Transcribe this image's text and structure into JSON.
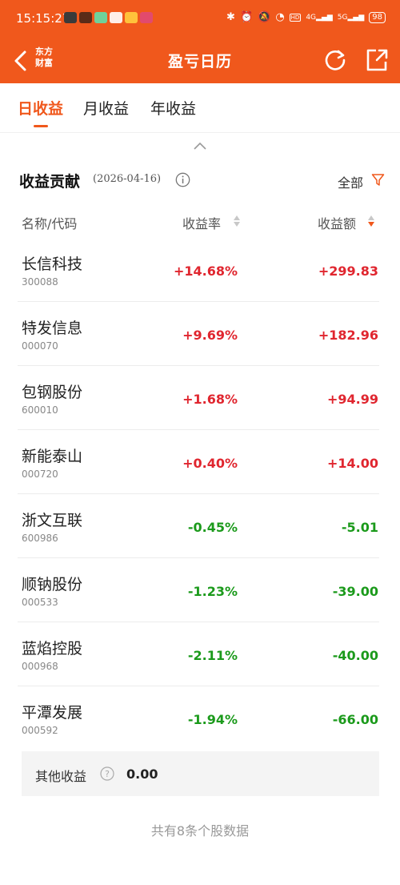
{
  "status_bar": {
    "time": "15:15:27",
    "network_4g": "4G",
    "network_5g": "5G",
    "hd_label": "HD",
    "battery": "98"
  },
  "nav": {
    "brand_line1": "东方",
    "brand_line2": "财富",
    "title": "盈亏日历"
  },
  "tabs": [
    {
      "label": "日收益",
      "active": true
    },
    {
      "label": "月收益",
      "active": false
    },
    {
      "label": "年收益",
      "active": false
    }
  ],
  "section": {
    "title": "收益贡献",
    "date": "(2026-04-16)",
    "filter_label": "全部"
  },
  "table": {
    "col_name": "名称/代码",
    "col_rate": "收益率",
    "col_amount": "收益额",
    "rows": [
      {
        "name": "长信科技",
        "code": "300088",
        "rate": "+14.68%",
        "amount": "+299.83",
        "direction": "up"
      },
      {
        "name": "特发信息",
        "code": "000070",
        "rate": "+9.69%",
        "amount": "+182.96",
        "direction": "up"
      },
      {
        "name": "包钢股份",
        "code": "600010",
        "rate": "+1.68%",
        "amount": "+94.99",
        "direction": "up"
      },
      {
        "name": "新能泰山",
        "code": "000720",
        "rate": "+0.40%",
        "amount": "+14.00",
        "direction": "up"
      },
      {
        "name": "浙文互联",
        "code": "600986",
        "rate": "-0.45%",
        "amount": "-5.01",
        "direction": "down"
      },
      {
        "name": "顺钠股份",
        "code": "000533",
        "rate": "-1.23%",
        "amount": "-39.00",
        "direction": "down"
      },
      {
        "name": "蓝焰控股",
        "code": "000968",
        "rate": "-2.11%",
        "amount": "-40.00",
        "direction": "down"
      },
      {
        "name": "平潭发展",
        "code": "000592",
        "rate": "-1.94%",
        "amount": "-66.00",
        "direction": "down"
      }
    ]
  },
  "other_income": {
    "label": "其他收益",
    "value": "0.00"
  },
  "footer": "共有8条个股数据",
  "colors": {
    "accent": "#f0581c",
    "gain": "#e0262f",
    "loss": "#1b9a1b"
  }
}
